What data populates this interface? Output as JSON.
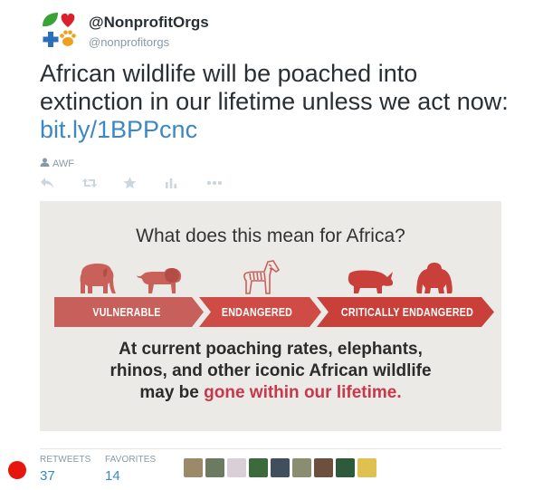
{
  "tweet": {
    "display_name": "@NonprofitOrgs",
    "handle": "@nonprofitorgs",
    "text": "African wildlife will be poached into extinction in our lifetime unless we act now:",
    "link": "bit.ly/1BPPcnc",
    "via": "AWF"
  },
  "actions": [
    {
      "name": "reply-icon"
    },
    {
      "name": "retweet-icon"
    },
    {
      "name": "favorite-icon"
    },
    {
      "name": "stats-icon"
    },
    {
      "name": "more-icon"
    }
  ],
  "media": {
    "title": "What does this mean for Africa?",
    "labels": [
      "VULNERABLE",
      "ENDANGERED",
      "CRITICALLY ENDANGERED"
    ],
    "body_line1": "At current poaching rates, elephants,",
    "body_line2": "rhinos, and other iconic African wildlife",
    "body_line3_prefix": "may be ",
    "body_line3_highlight": "gone within our lifetime.",
    "colors": {
      "background": "#ebeae6",
      "arrow": "#c75f5a",
      "arrow_dark": "#c9403a",
      "highlight": "#c8374a"
    }
  },
  "stats": {
    "retweets_label": "RETWEETS",
    "retweets_value": "37",
    "favorites_label": "FAVORITES",
    "favorites_value": "14"
  },
  "avatars": [
    "#9b8a6a",
    "#6b7a60",
    "#d9cfd6",
    "#3c6a3a",
    "#3f4f5e",
    "#8a8d6f",
    "#6e4f3e",
    "#2d5a3a",
    "#e0c150"
  ]
}
